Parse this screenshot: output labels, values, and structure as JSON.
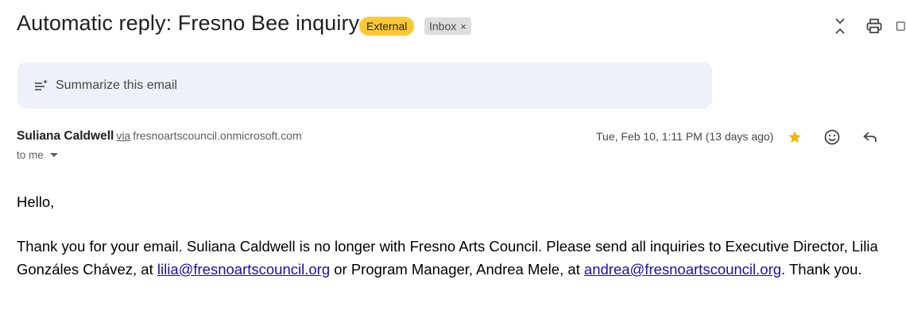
{
  "email": {
    "subject": "Automatic reply: Fresno Bee inquiry",
    "labels": {
      "external": "External",
      "inbox": "Inbox",
      "inbox_remove": "×"
    },
    "summarize_label": "Summarize this email",
    "sender": {
      "name": "Suliana Caldwell",
      "via": "via",
      "domain": "fresnoartscouncil.onmicrosoft.com"
    },
    "recipient_label": "to me",
    "date": "Tue, Feb 10, 1:11 PM (13 days ago)",
    "starred": true,
    "body": {
      "greeting": "Hello,",
      "line1": "Thank you for your email. Suliana Caldwell is no longer with Fresno Arts Council. Please send all inquiries to Executive Director, Lilia",
      "line2_a": "Gonzáles Chávez, at ",
      "link1": "lilia@fresnoartscouncil.org",
      "line2_b": " or Program Manager, Andrea Mele, at ",
      "link2": "andrea@fresnoartscouncil.org",
      "line2_c": ". Thank you."
    }
  },
  "icons": {
    "collapse": "collapse-icon",
    "print": "print-icon",
    "open_new_window": "open-in-new-window-icon",
    "summarize": "summarize-icon",
    "star": "star-icon",
    "emoji": "emoji-reaction-icon",
    "reply": "reply-icon"
  },
  "colors": {
    "external_badge": "#fcc934",
    "inbox_badge": "#dddddd",
    "summarize_bg": "#eef1f9",
    "star": "#f4b400",
    "link": "#1a0dab"
  }
}
